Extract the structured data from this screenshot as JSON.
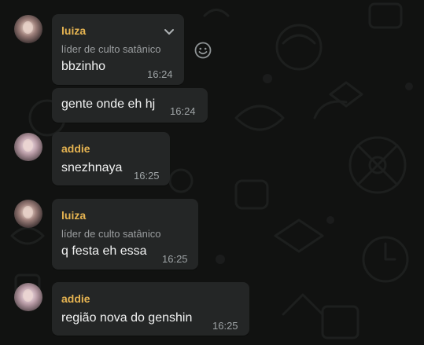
{
  "messages": [
    {
      "sender": "luiza",
      "subtitle": "líder de culto satânico",
      "text": "bbzinho",
      "time": "16:24",
      "avatar_icon": "luiza-avatar"
    },
    {
      "text": "gente onde eh hj",
      "time": "16:24"
    },
    {
      "sender": "addie",
      "text": "snezhnaya",
      "time": "16:25",
      "avatar_icon": "addie-avatar"
    },
    {
      "sender": "luiza",
      "subtitle": "líder de culto satânico",
      "text": "q festa eh essa",
      "time": "16:25",
      "avatar_icon": "luiza-avatar"
    },
    {
      "sender": "addie",
      "text": "região nova do genshin",
      "time": "16:25",
      "avatar_icon": "addie-avatar"
    }
  ],
  "colors": {
    "background": "#111211",
    "bubble": "#242626",
    "sender_name": "#e6b451",
    "message_text": "#f1f2f2",
    "meta_text": "#9ea3a5"
  },
  "icons": [
    "chevron-down-icon",
    "emoji-icon"
  ]
}
